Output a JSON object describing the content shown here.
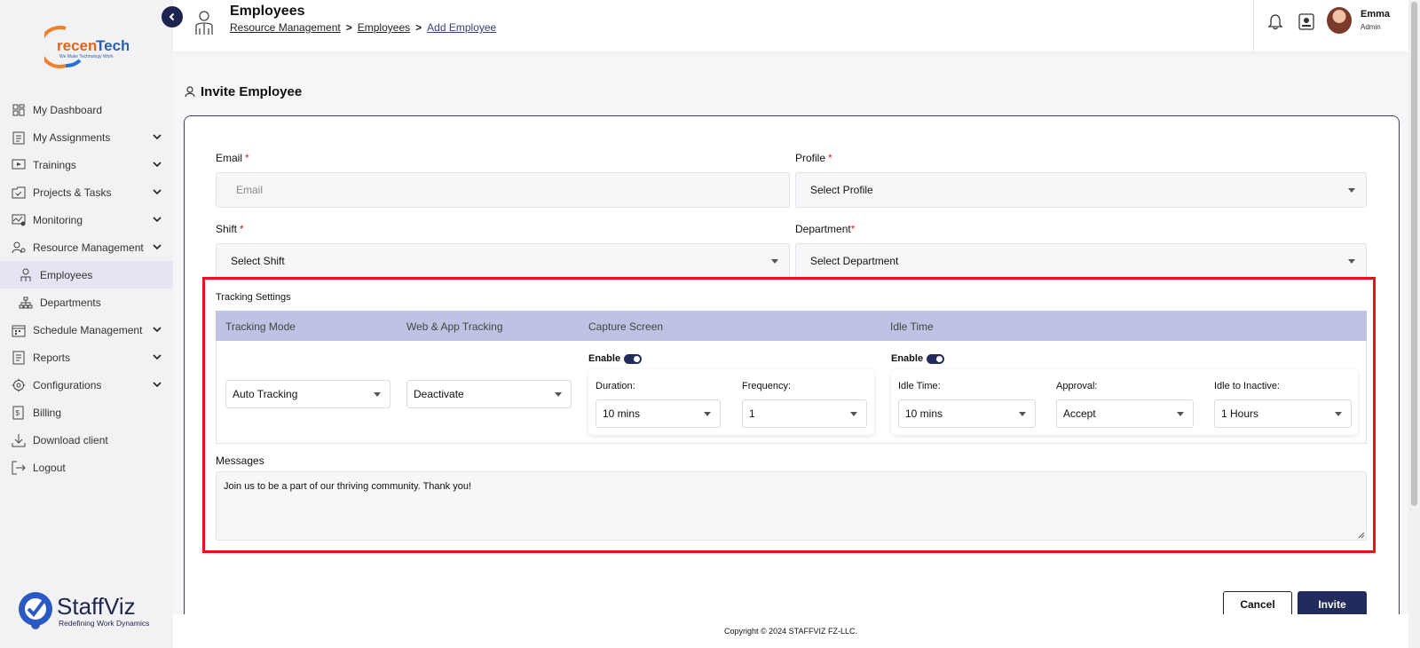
{
  "logo": {
    "text_main": "recenTech",
    "tagline": "We Make Technology Work"
  },
  "sidebar": {
    "items": [
      {
        "label": "My Dashboard",
        "icon": "dashboard-icon",
        "chevron": false
      },
      {
        "label": "My Assignments",
        "icon": "assignments-icon",
        "chevron": true
      },
      {
        "label": "Trainings",
        "icon": "training-icon",
        "chevron": true
      },
      {
        "label": "Projects & Tasks",
        "icon": "projects-icon",
        "chevron": true
      },
      {
        "label": "Monitoring",
        "icon": "monitoring-icon",
        "chevron": true
      },
      {
        "label": "Resource Management",
        "icon": "resource-icon",
        "chevron": true
      },
      {
        "label": "Employees",
        "icon": "employee-icon",
        "chevron": false,
        "sub": true,
        "active": true
      },
      {
        "label": "Departments",
        "icon": "departments-icon",
        "chevron": false,
        "sub": true
      },
      {
        "label": "Schedule Management",
        "icon": "schedule-icon",
        "chevron": true
      },
      {
        "label": "Reports",
        "icon": "reports-icon",
        "chevron": true
      },
      {
        "label": "Configurations",
        "icon": "configurations-icon",
        "chevron": true
      },
      {
        "label": "Billing",
        "icon": "billing-icon",
        "chevron": false
      },
      {
        "label": "Download client",
        "icon": "download-icon",
        "chevron": false
      },
      {
        "label": "Logout",
        "icon": "logout-icon",
        "chevron": false
      }
    ]
  },
  "brand": {
    "name": "StaffViz",
    "tagline": "Redefining Work Dynamics"
  },
  "header": {
    "title": "Employees",
    "breadcrumb": [
      "Resource Management",
      "Employees",
      "Add Employee"
    ],
    "user_name": "Emma",
    "user_role": "Admin"
  },
  "form": {
    "section_title": "Invite Employee",
    "email_label": "Email",
    "email_placeholder": "Email",
    "profile_label": "Profile",
    "profile_value": "Select Profile",
    "shift_label": "Shift",
    "shift_value": "Select Shift",
    "department_label": "Department",
    "department_value": "Select Department",
    "required_mark": "*"
  },
  "tracking": {
    "title": "Tracking Settings",
    "columns": [
      "Tracking Mode",
      "Web & App Tracking",
      "Capture Screen",
      "Idle Time"
    ],
    "tracking_mode": "Auto Tracking",
    "web_app": "Deactivate",
    "enable_label": "Enable",
    "capture": {
      "enabled": true,
      "duration_label": "Duration:",
      "duration": "10 mins",
      "frequency_label": "Frequency:",
      "frequency": "1"
    },
    "idle": {
      "enabled": true,
      "idle_time_label": "Idle Time:",
      "idle_time": "10 mins",
      "approval_label": "Approval:",
      "approval": "Accept",
      "idle_inactive_label": "Idle to Inactive:",
      "idle_inactive": "1 Hours"
    }
  },
  "messages": {
    "label": "Messages",
    "text": "Join us to be a part of our thriving community. Thank you!"
  },
  "buttons": {
    "cancel": "Cancel",
    "invite": "Invite"
  },
  "footer": {
    "copyright": "Copyright © 2024 STAFFVIZ FZ-LLC."
  },
  "colors": {
    "primary": "#232a5c",
    "table_header": "#bfc3e3",
    "highlight": "#e8121c",
    "required": "#e02020"
  }
}
